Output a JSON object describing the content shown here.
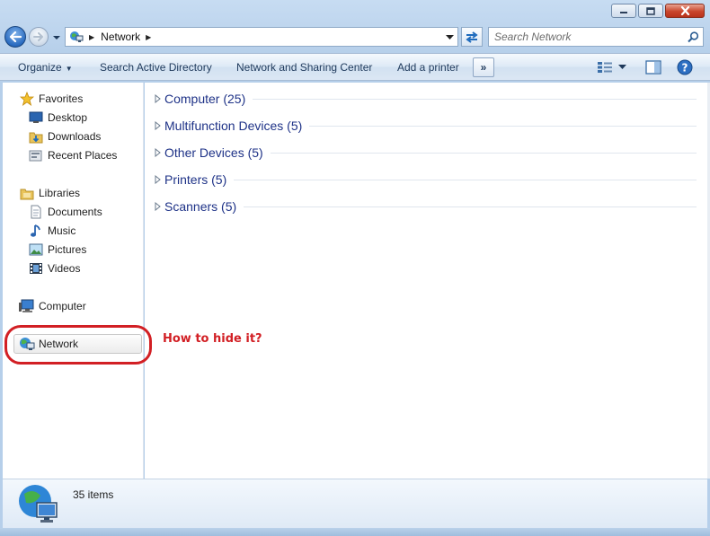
{
  "window": {
    "buttons": {
      "minimize": "minimize-icon",
      "maximize": "maximize-icon",
      "close": "close-icon"
    }
  },
  "navigation": {
    "address": {
      "crumbs": [
        "Network"
      ],
      "icon": "network-icon"
    },
    "search": {
      "placeholder": "Search Network"
    }
  },
  "toolbar": {
    "organize": "Organize",
    "search_ad": "Search Active Directory",
    "network_sharing": "Network and Sharing Center",
    "add_printer": "Add a printer",
    "more": "»"
  },
  "sidebar": {
    "favorites": {
      "label": "Favorites",
      "items": [
        "Desktop",
        "Downloads",
        "Recent Places"
      ]
    },
    "libraries": {
      "label": "Libraries",
      "items": [
        "Documents",
        "Music",
        "Pictures",
        "Videos"
      ]
    },
    "computer": "Computer",
    "network": "Network"
  },
  "groups": [
    "Computer (25)",
    "Multifunction Devices (5)",
    "Other Devices (5)",
    "Printers (5)",
    "Scanners (5)"
  ],
  "annotation": {
    "text": "How to hide it?",
    "color": "#d21f24"
  },
  "status": {
    "count": "35 items"
  },
  "colors": {
    "accent": "#1e3287",
    "annotation": "#d21f24",
    "toolbar_text": "#1e395b"
  }
}
